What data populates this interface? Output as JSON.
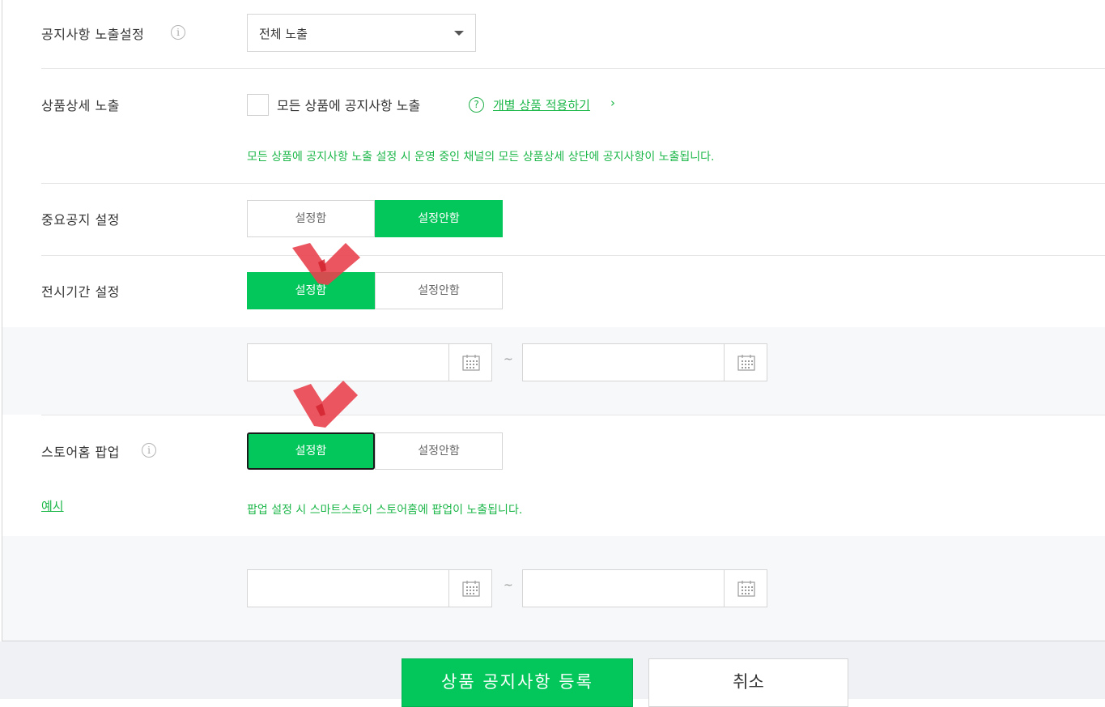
{
  "notice_exposure": {
    "label": "공지사항 노출설정",
    "info_icon": "i",
    "select_value": "전체 노출"
  },
  "product_detail": {
    "label": "상품상세 노출",
    "checkbox_label": "모든 상품에 공지사항 노출",
    "help_icon": "?",
    "link_text": "개별 상품 적용하기",
    "link_arrow": "›",
    "note": "모든 상품에 공지사항 노출 설정 시 운영 중인 채널의 모든 상품상세 상단에 공지사항이 노출됩니다."
  },
  "important_notice": {
    "label": "중요공지 설정",
    "options": [
      "설정함",
      "설정안함"
    ],
    "selected": "설정안함"
  },
  "display_period": {
    "label": "전시기간 설정",
    "options": [
      "설정함",
      "설정안함"
    ],
    "selected": "설정함",
    "range_separator": "~"
  },
  "store_popup": {
    "label": "스토어홈 팝업",
    "info_icon": "i",
    "options": [
      "설정함",
      "설정안함"
    ],
    "selected": "설정함",
    "example_link": "예시",
    "note": "팝업 설정 시 스마트스토어 스토어홈에 팝업이 노출됩니다.",
    "range_separator": "~"
  },
  "footer": {
    "submit_label": "상품 공지사항 등록",
    "cancel_label": "취소"
  },
  "colors": {
    "accent": "#03c75a",
    "note_green": "#1db74a",
    "annotation_red": "#e8434e"
  }
}
